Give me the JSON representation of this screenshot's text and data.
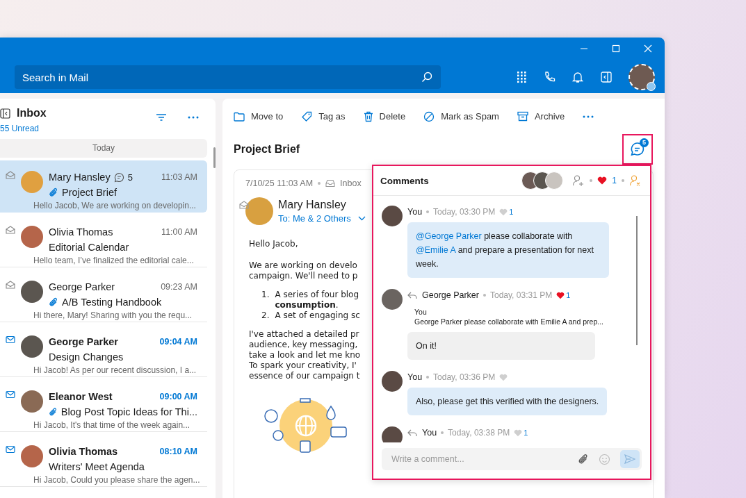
{
  "search": {
    "placeholder": "Search in Mail"
  },
  "inbox": {
    "title": "Inbox",
    "unread": "55 Unread",
    "group": "Today",
    "messages": [
      {
        "sender": "Mary Hansley",
        "comments": "5",
        "time": "11:03 AM",
        "subject": "Project Brief",
        "attachment": true,
        "preview": "Hello Jacob, We are working on developin...",
        "unread": false,
        "selected": true
      },
      {
        "sender": "Olivia Thomas",
        "time": "11:00 AM",
        "subject": "Editorial Calendar",
        "attachment": false,
        "preview": "Hello team, I’ve finalized the editorial cale...",
        "unread": false,
        "selected": false
      },
      {
        "sender": "George Parker",
        "time": "09:23 AM",
        "subject": "A/B Testing Handbook",
        "attachment": true,
        "preview": "Hi there, Mary! Sharing with you the requ...",
        "unread": false,
        "selected": false
      },
      {
        "sender": "George Parker",
        "time": "09:04 AM",
        "subject": "Design Changes",
        "attachment": false,
        "preview": "Hi Jacob! As per our recent discussion, I a...",
        "unread": true,
        "selected": false
      },
      {
        "sender": "Eleanor West",
        "time": "09:00 AM",
        "subject": "Blog Post Topic Ideas for Thi...",
        "attachment": true,
        "preview": "Hi Jacob, It's that time of the week again...",
        "unread": true,
        "selected": false
      },
      {
        "sender": "Olivia Thomas",
        "time": "08:10 AM",
        "subject": "Writers' Meet Agenda",
        "attachment": false,
        "preview": "Hi Jacob, Could you please share the agen...",
        "unread": true,
        "selected": false
      }
    ]
  },
  "toolbar": [
    "Move to",
    "Tag as",
    "Delete",
    "Mark as Spam",
    "Archive"
  ],
  "email": {
    "subject": "Project Brief",
    "date": "7/10/25 11:03 AM",
    "folder": "Inbox",
    "sender": "Mary Hansley",
    "recipients": "To: Me & 2 Others",
    "greeting": "Hello Jacob,",
    "paragraph_1": [
      "We are working on develo",
      "campaign. We'll need to p"
    ],
    "list": [
      {
        "number": "1.",
        "lines": [
          "A series of four blog",
          "**consumption**."
        ]
      },
      {
        "number": "2.",
        "lines": [
          "A set of engaging sc"
        ]
      }
    ],
    "paragraph_2": [
      "I've attached a detailed pr",
      "audience, key messaging,",
      "take a look and let me kno",
      "To spark your creativity, I'",
      "essence of our campaign t"
    ]
  },
  "comments": {
    "highlighted": true,
    "count": "5",
    "title": "Comments",
    "likes": "1",
    "placeholder": "Write a comment...",
    "items": [
      {
        "author": "You",
        "reply": false,
        "time": "Today, 03:30 PM",
        "liked": false,
        "likes": "1",
        "mine": true,
        "segments": [
          {
            "text": "@George Parker",
            "mention": true
          },
          {
            "text": " please collaborate with ",
            "mention": false
          },
          {
            "text": "@Emilie A",
            "mention": true
          },
          {
            "text": " and prepare a presentation for next week.",
            "mention": false
          }
        ]
      },
      {
        "author": "George Parker",
        "reply": true,
        "time": "Today, 03:31 PM",
        "liked": true,
        "likes": "1",
        "mine": false,
        "quote": {
          "author": "You",
          "text": "George Parker please collaborate with Emilie A and prep..."
        },
        "segments": [
          {
            "text": "On it!",
            "mention": false
          }
        ]
      },
      {
        "author": "You",
        "reply": false,
        "time": "Today, 03:36 PM",
        "liked": false,
        "mine": true,
        "segments": [
          {
            "text": "Also, please get this verified with the designers.",
            "mention": false
          }
        ]
      },
      {
        "author": "You",
        "reply": true,
        "time": "Today, 03:38 PM",
        "liked": false,
        "likes": "1",
        "mine": true
      }
    ]
  }
}
